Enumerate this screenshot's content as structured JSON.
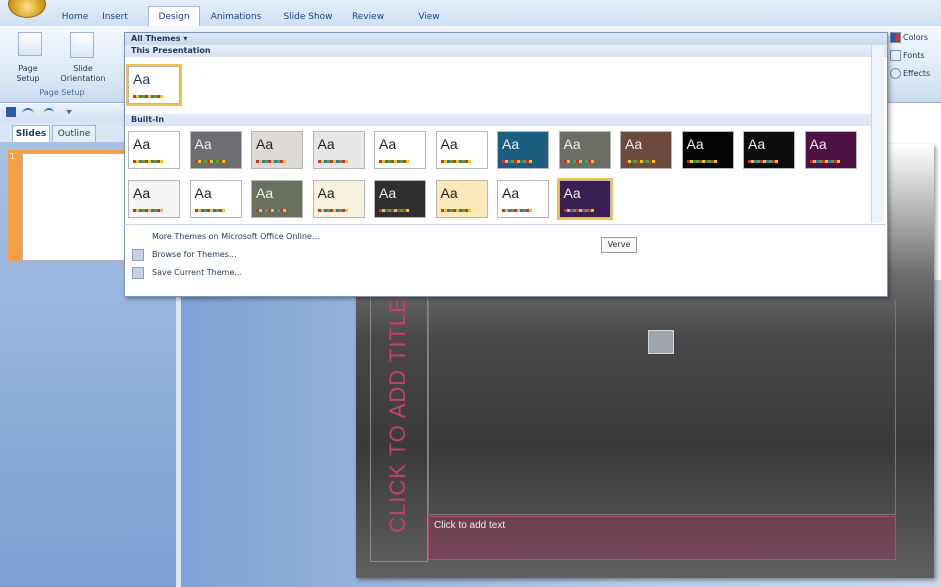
{
  "ribbon": {
    "tabs": [
      "Home",
      "Insert",
      "Design",
      "Animations",
      "Slide Show",
      "Review",
      "View"
    ],
    "active_tab": "Design",
    "page_setup_label": "Page Setup",
    "slide_orientation_label": "Slide Orientation",
    "group_page_setup": "Page Setup",
    "options": [
      "Colors",
      "Fonts",
      "Effects"
    ]
  },
  "panel": {
    "tabs": [
      "Slides",
      "Outline"
    ],
    "thumb_number": "1"
  },
  "gallery": {
    "title": "All Themes",
    "section_this": "This Presentation",
    "section_builtin": "Built-In",
    "tile_text": "Aa",
    "links": [
      "More Themes on Microsoft Office Online...",
      "Browse for Themes...",
      "Save Current Theme..."
    ],
    "tooltip": "Verve",
    "colors": {
      "row1": [
        "#ffffff",
        "#6d6d72",
        "#dedad6",
        "#e7e7e7",
        "#ffffff",
        "#ffffff",
        "#1c5e80",
        "#6b6e63",
        "#6c4a3e",
        "#050505",
        "#0d0d0d",
        "#4e1045"
      ],
      "row2": [
        "#f5f5f5",
        "#ffffff",
        "#6a7060",
        "#f8f1dd",
        "#2f2f2f",
        "#fbe9b9",
        "#ffffff",
        "#3b1f52"
      ]
    }
  },
  "slide": {
    "title_placeholder": "CLICK TO ADD TITLE",
    "content_placeholder": "Click to add text"
  }
}
